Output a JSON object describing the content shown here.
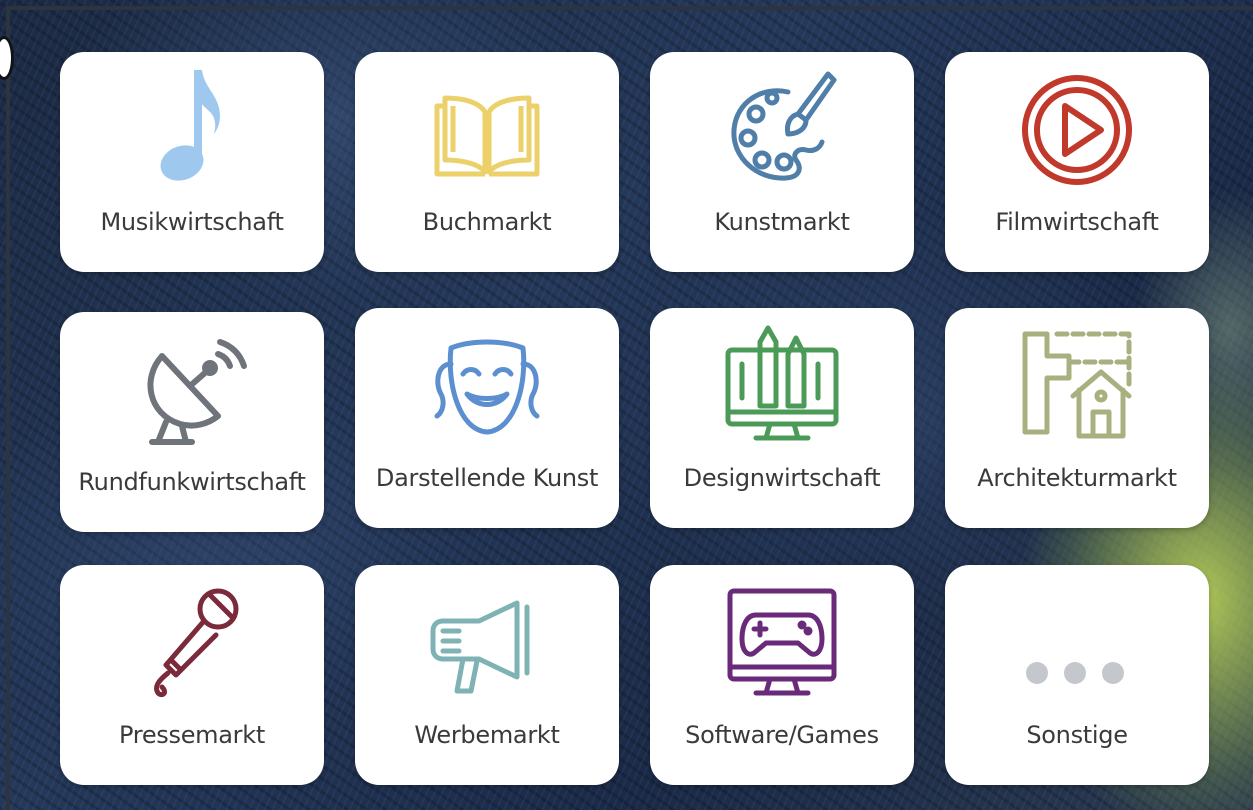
{
  "tiles": [
    {
      "label": "Musikwirtschaft",
      "icon": "music-note-icon",
      "color": "#9ec8ee"
    },
    {
      "label": "Buchmarkt",
      "icon": "open-book-icon",
      "color": "#ecd06a"
    },
    {
      "label": "Kunstmarkt",
      "icon": "palette-icon",
      "color": "#4f7ea8"
    },
    {
      "label": "Filmwirtschaft",
      "icon": "play-icon",
      "color": "#c0392b"
    },
    {
      "label": "Rundfunkwirtschaft",
      "icon": "satellite-dish-icon",
      "color": "#6f747a"
    },
    {
      "label": "Darstellende Kunst",
      "icon": "theater-mask-icon",
      "color": "#5b8fcf"
    },
    {
      "label": "Designwirtschaft",
      "icon": "design-monitor-icon",
      "color": "#4c9a57"
    },
    {
      "label": "Architekturmarkt",
      "icon": "architecture-icon",
      "color": "#a7b07f"
    },
    {
      "label": "Pressemarkt",
      "icon": "microphone-icon",
      "color": "#7a2a3a"
    },
    {
      "label": "Werbemarkt",
      "icon": "megaphone-icon",
      "color": "#7fb2b5"
    },
    {
      "label": "Software/Games",
      "icon": "gamepad-monitor-icon",
      "color": "#6a2a7a"
    },
    {
      "label": "Sonstige",
      "icon": "more-dots-icon",
      "color": "#c4c7cc"
    }
  ]
}
